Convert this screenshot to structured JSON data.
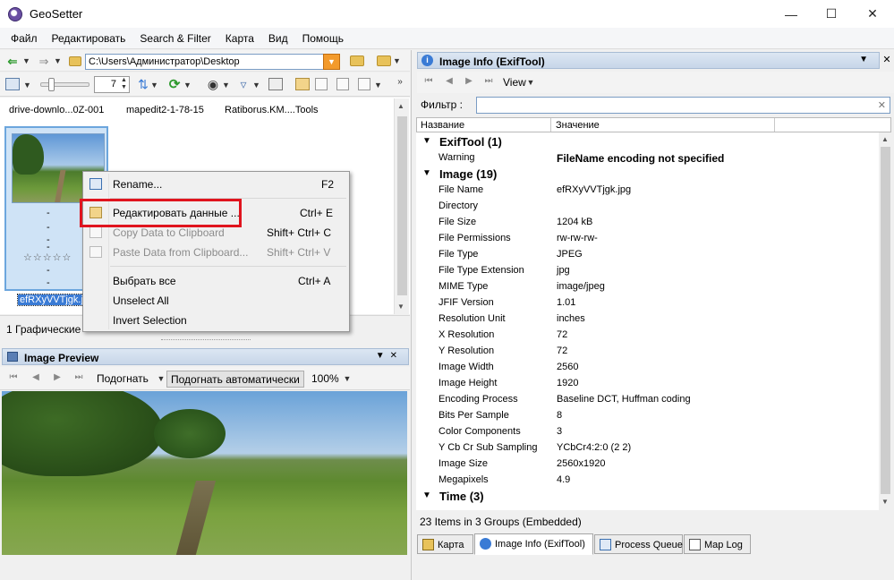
{
  "window": {
    "title": "GeoSetter"
  },
  "menu": [
    "Файл",
    "Редактировать",
    "Search & Filter",
    "Карта",
    "Вид",
    "Помощь"
  ],
  "path": {
    "value": "C:\\Users\\Администратор\\Desktop"
  },
  "thumb_size": "7",
  "file_list": {
    "header_items": [
      "drive-downlo...0Z-001",
      "mapedit2-1-78-15",
      "Ratiborus.KM....Tools"
    ],
    "selected_file": "efRXyVVTjgk.jpg",
    "stars": "☆☆☆☆☆",
    "dashes": [
      "-",
      "-",
      "-",
      "-",
      "-",
      "-"
    ]
  },
  "left_status": "1 Графические",
  "context_menu": {
    "items": [
      {
        "label": "Rename...",
        "shortcut": "F2",
        "icon": "rename-icon"
      },
      {
        "label": "Редактировать данные ...",
        "shortcut": "Ctrl+ E",
        "icon": "edit-data-icon"
      },
      {
        "label": "Copy Data to Clipboard",
        "shortcut": "Shift+ Ctrl+ C",
        "icon": "copy-icon"
      },
      {
        "label": "Paste Data from Clipboard...",
        "shortcut": "Shift+ Ctrl+ V",
        "icon": "paste-icon"
      },
      {
        "label": "Выбрать все",
        "shortcut": "Ctrl+ A"
      },
      {
        "label": "Unselect All",
        "shortcut": ""
      },
      {
        "label": "Invert Selection",
        "shortcut": ""
      }
    ]
  },
  "preview": {
    "title": "Image Preview",
    "fit_label": "Подогнать",
    "auto_fit_label": "Подогнать автоматически",
    "zoom": "100%"
  },
  "info_panel": {
    "title": "Image Info (ExifTool)",
    "view_label": "View",
    "filter_label": "Фильтр :",
    "col_name": "Название",
    "col_value": "Значение",
    "groups": [
      {
        "name": "ExifTool (1)",
        "rows": [
          {
            "k": "Warning",
            "v": "FileName encoding not specified"
          }
        ]
      },
      {
        "name": "Image (19)",
        "rows": [
          {
            "k": "File Name",
            "v": "efRXyVVTjgk.jpg"
          },
          {
            "k": "Directory",
            "v": ""
          },
          {
            "k": "File Size",
            "v": "1204 kB"
          },
          {
            "k": "File Permissions",
            "v": "rw-rw-rw-"
          },
          {
            "k": "File Type",
            "v": "JPEG"
          },
          {
            "k": "File Type Extension",
            "v": "jpg"
          },
          {
            "k": "MIME Type",
            "v": "image/jpeg"
          },
          {
            "k": "JFIF Version",
            "v": "1.01"
          },
          {
            "k": "Resolution Unit",
            "v": "inches"
          },
          {
            "k": "X Resolution",
            "v": "72"
          },
          {
            "k": "Y Resolution",
            "v": "72"
          },
          {
            "k": "Image Width",
            "v": "2560"
          },
          {
            "k": "Image Height",
            "v": "1920"
          },
          {
            "k": "Encoding Process",
            "v": "Baseline DCT, Huffman coding"
          },
          {
            "k": "Bits Per Sample",
            "v": "8"
          },
          {
            "k": "Color Components",
            "v": "3"
          },
          {
            "k": "Y Cb Cr Sub Sampling",
            "v": "YCbCr4:2:0 (2 2)"
          },
          {
            "k": "Image Size",
            "v": "2560x1920"
          },
          {
            "k": "Megapixels",
            "v": "4.9"
          }
        ]
      },
      {
        "name": "Time (3)",
        "rows": []
      }
    ],
    "status": "23 Items in 3 Groups   (Embedded)"
  },
  "tabs": [
    {
      "label": "Карта",
      "icon": "map-icon"
    },
    {
      "label": "Image Info (ExifTool)",
      "icon": "info-icon"
    },
    {
      "label": "Process Queue",
      "icon": "queue-icon"
    },
    {
      "label": "Map Log",
      "icon": "log-icon"
    }
  ],
  "colors": {
    "highlight_box": "#e0141e",
    "selection": "#3a7bd5",
    "panel_header": "#c7d6e8"
  }
}
